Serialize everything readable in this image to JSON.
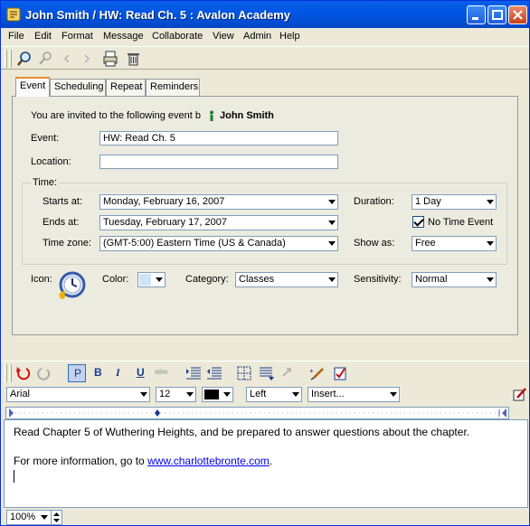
{
  "window": {
    "title": "John Smith / HW: Read Ch. 5 : Avalon Academy"
  },
  "menu": [
    "File",
    "Edit",
    "Format",
    "Message",
    "Collaborate",
    "View",
    "Admin",
    "Help"
  ],
  "toolbar": {
    "icons": [
      "find-icon",
      "address-icon",
      "back-icon",
      "forward-icon",
      "print-icon",
      "delete-icon"
    ]
  },
  "tabs": [
    "Event",
    "Scheduling",
    "Repeat",
    "Reminders"
  ],
  "event": {
    "invite_text": "You are invited to the following event b",
    "invite_from": "John Smith",
    "event_label": "Event:",
    "event_value": "HW: Read Ch. 5",
    "location_label": "Location:",
    "location_value": "",
    "time_group": "Time:",
    "starts_label": "Starts at:",
    "starts_value": "Monday, February 16, 2007",
    "ends_label": "Ends at:",
    "ends_value": "Tuesday, February 17, 2007",
    "timezone_label": "Time zone:",
    "timezone_value": "(GMT-5:00) Eastern Time (US & Canada)",
    "duration_label": "Duration:",
    "duration_value": "1 Day",
    "no_time_label": "No Time Event",
    "no_time_checked": true,
    "showas_label": "Show as:",
    "showas_value": "Free",
    "icon_label": "Icon:",
    "color_label": "Color:",
    "color_value": "#cfe3f7",
    "category_label": "Category:",
    "category_value": "Classes",
    "sensitivity_label": "Sensitivity:",
    "sensitivity_value": "Normal"
  },
  "format": {
    "font": "Arial",
    "size": "12",
    "color_value": "#000000",
    "align": "Left",
    "insert": "Insert..."
  },
  "body": {
    "line1": "Read Chapter 5 of Wuthering Heights, and be prepared to answer questions about the chapter.",
    "line2_prefix": "For more information, go to ",
    "link": "www.charlottebronte.com",
    "line2_suffix": "."
  },
  "status": {
    "zoom": "100%"
  }
}
